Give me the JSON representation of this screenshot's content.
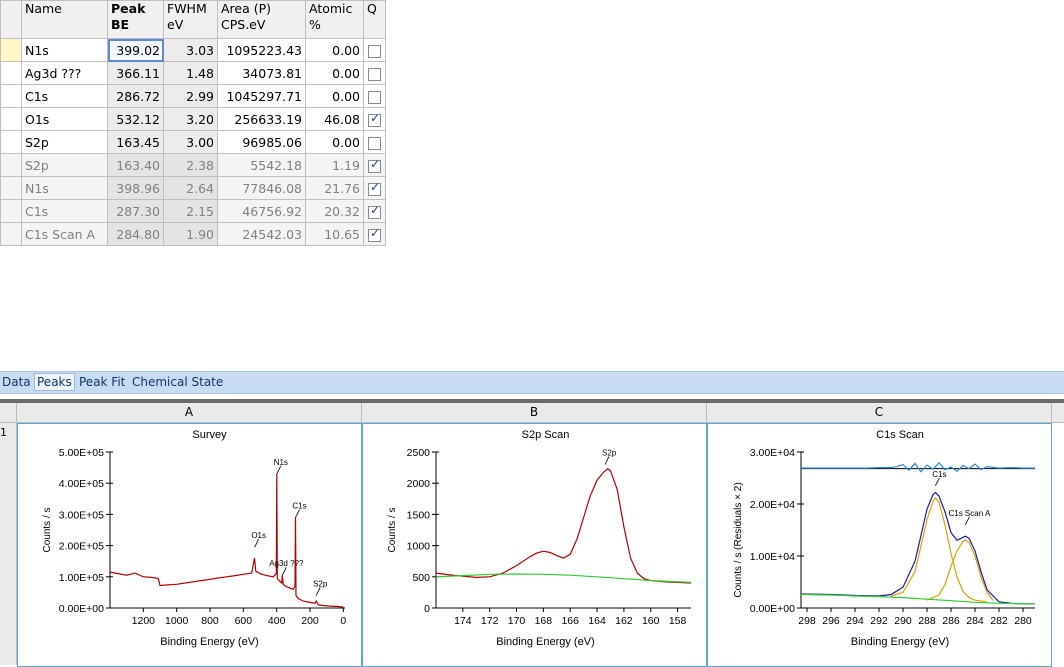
{
  "table": {
    "headers": [
      {
        "line1": "Name",
        "line2": ""
      },
      {
        "line1": "Peak",
        "line2": "BE"
      },
      {
        "line1": "FWHM",
        "line2": "eV"
      },
      {
        "line1": "Area (P)",
        "line2": "CPS.eV"
      },
      {
        "line1": "Atomic",
        "line2": "%"
      },
      {
        "line1": "Q",
        "line2": ""
      }
    ],
    "rows": [
      {
        "name": "N1s",
        "be": "399.02",
        "fwhm": "3.03",
        "area": "1095223.43",
        "atomic": "0.00",
        "q": false,
        "dim": false
      },
      {
        "name": "Ag3d ???",
        "be": "366.11",
        "fwhm": "1.48",
        "area": "34073.81",
        "atomic": "0.00",
        "q": false,
        "dim": false
      },
      {
        "name": "C1s",
        "be": "286.72",
        "fwhm": "2.99",
        "area": "1045297.71",
        "atomic": "0.00",
        "q": false,
        "dim": false
      },
      {
        "name": "O1s",
        "be": "532.12",
        "fwhm": "3.20",
        "area": "256633.19",
        "atomic": "46.08",
        "q": true,
        "dim": false
      },
      {
        "name": "S2p",
        "be": "163.45",
        "fwhm": "3.00",
        "area": "96985.06",
        "atomic": "0.00",
        "q": false,
        "dim": false
      },
      {
        "name": "S2p",
        "be": "163.40",
        "fwhm": "2.38",
        "area": "5542.18",
        "atomic": "1.19",
        "q": true,
        "dim": true
      },
      {
        "name": "N1s",
        "be": "398.96",
        "fwhm": "2.64",
        "area": "77846.08",
        "atomic": "21.76",
        "q": true,
        "dim": true
      },
      {
        "name": "C1s",
        "be": "287.30",
        "fwhm": "2.15",
        "area": "46756.92",
        "atomic": "20.32",
        "q": true,
        "dim": true
      },
      {
        "name": "C1s Scan A",
        "be": "284.80",
        "fwhm": "1.90",
        "area": "24542.03",
        "atomic": "10.65",
        "q": true,
        "dim": true
      }
    ]
  },
  "tabs": [
    "Data",
    "Peaks",
    "Peak Fit",
    "Chemical State"
  ],
  "active_tab": "Peaks",
  "grid": {
    "row_label": "1",
    "columns": [
      "A",
      "B",
      "C"
    ]
  },
  "colors": {
    "spectrum": "#b30000",
    "background": "#33cc33",
    "component": "#e0a000",
    "envelope": "#1a1aaa",
    "residual": "#2a8ad8",
    "panel_border": "#5aa8d8",
    "tabbar": "#c7dcf2"
  },
  "chart_data": [
    {
      "type": "line",
      "title": "Survey",
      "xlabel": "Binding Energy (eV)",
      "ylabel": "Counts / s",
      "xlim": [
        1400,
        -10
      ],
      "ylim": [
        0,
        500000
      ],
      "x_ticks": [
        "1200",
        "1000",
        "800",
        "600",
        "400",
        "200",
        "0"
      ],
      "y_ticks": [
        "0.00E+00",
        "1.00E+05",
        "2.00E+05",
        "3.00E+05",
        "4.00E+05",
        "5.00E+05"
      ],
      "annotations": [
        {
          "label": "N1s",
          "x": 399,
          "y": 430000
        },
        {
          "label": "O1s",
          "x": 532,
          "y": 195000
        },
        {
          "label": "C1s",
          "x": 287,
          "y": 290000
        },
        {
          "label": "Ag3d ???",
          "x": 366,
          "y": 105000
        },
        {
          "label": "S2p",
          "x": 163,
          "y": 40000
        }
      ],
      "series": [
        {
          "x": [
            1400,
            1300,
            1250,
            1200,
            1150,
            1110,
            1100,
            1050,
            1000,
            950,
            900,
            850,
            800,
            750,
            700,
            650,
            600,
            550,
            533,
            525,
            500,
            460,
            420,
            402,
            399,
            396,
            380,
            370,
            366,
            360,
            340,
            300,
            290,
            287,
            284,
            270,
            240,
            200,
            170,
            163,
            150,
            120,
            80,
            40,
            10,
            0
          ],
          "y": [
            115000,
            105000,
            112000,
            100000,
            98000,
            95000,
            72000,
            74000,
            76000,
            80000,
            84000,
            88000,
            92000,
            96000,
            100000,
            104000,
            108000,
            112000,
            160000,
            118000,
            110000,
            104000,
            100000,
            110000,
            430000,
            95000,
            85000,
            80000,
            105000,
            75000,
            68000,
            60000,
            70000,
            290000,
            40000,
            30000,
            22000,
            18000,
            15000,
            22000,
            10000,
            8000,
            6000,
            5000,
            4000,
            3000
          ]
        }
      ]
    },
    {
      "type": "line",
      "title": "S2p Scan",
      "xlabel": "Binding Energy (eV)",
      "ylabel": "Counts / s",
      "xlim": [
        176,
        157
      ],
      "ylim": [
        0,
        2500
      ],
      "x_ticks": [
        "174",
        "172",
        "170",
        "168",
        "166",
        "164",
        "162",
        "160",
        "158"
      ],
      "y_ticks": [
        "0",
        "500",
        "1000",
        "1500",
        "2000",
        "2500"
      ],
      "annotations": [
        {
          "label": "S2p",
          "x": 163.4,
          "y": 2300
        }
      ],
      "series": [
        {
          "name": "spectrum",
          "x": [
            176,
            175,
            174,
            173,
            172,
            171,
            170,
            169,
            168.5,
            168,
            167.5,
            167,
            166.5,
            166,
            165.5,
            165,
            164.5,
            164,
            163.5,
            163.2,
            163,
            162.5,
            162,
            161.5,
            161,
            160.5,
            160,
            159,
            158,
            157
          ],
          "y": [
            560,
            530,
            510,
            490,
            500,
            560,
            680,
            820,
            880,
            910,
            890,
            840,
            800,
            860,
            1100,
            1450,
            1800,
            2050,
            2180,
            2230,
            2200,
            1900,
            1300,
            800,
            560,
            470,
            440,
            420,
            410,
            400
          ]
        },
        {
          "name": "background",
          "x": [
            176,
            174,
            172,
            170,
            168,
            166,
            164,
            162,
            160,
            158,
            157
          ],
          "y": [
            500,
            520,
            540,
            545,
            540,
            525,
            500,
            470,
            440,
            420,
            410
          ]
        }
      ]
    },
    {
      "type": "line",
      "title": "C1s Scan",
      "xlabel": "Binding Energy (eV)",
      "ylabel": "Counts / s  (Residuals × 2)",
      "xlim": [
        298.5,
        279
      ],
      "ylim": [
        0,
        30000
      ],
      "x_ticks": [
        "298",
        "296",
        "294",
        "292",
        "290",
        "288",
        "286",
        "284",
        "282",
        "280"
      ],
      "y_ticks": [
        "0.00E+00",
        "1.00E+04",
        "2.00E+04",
        "3.00E+04"
      ],
      "annotations": [
        {
          "label": "C1s",
          "x": 287.3,
          "y": 23500
        },
        {
          "label": "C1s Scan A",
          "x": 284.8,
          "y": 16000
        }
      ],
      "series": [
        {
          "name": "envelope",
          "x": [
            298.5,
            296,
            294,
            292,
            291,
            290,
            289,
            288.5,
            288,
            287.5,
            287.3,
            287,
            286.5,
            286,
            285.5,
            285,
            284.8,
            284.5,
            284,
            283.5,
            283,
            282,
            281,
            280,
            279
          ],
          "y": [
            2700,
            2600,
            2400,
            2300,
            2600,
            4000,
            9000,
            14000,
            19000,
            21800,
            22200,
            21500,
            18500,
            14500,
            13000,
            13600,
            13800,
            13400,
            11000,
            7000,
            3500,
            1200,
            900,
            800,
            800
          ]
        },
        {
          "name": "C1s component",
          "x": [
            291,
            290,
            289,
            288.5,
            288,
            287.5,
            287.3,
            287,
            286.5,
            286,
            285.5,
            285,
            284.5,
            284,
            283
          ],
          "y": [
            2300,
            3000,
            7000,
            12000,
            17000,
            20500,
            21200,
            20300,
            16000,
            10500,
            6000,
            3200,
            2000,
            1500,
            1200
          ]
        },
        {
          "name": "C1s Scan A component",
          "x": [
            288,
            287,
            286.5,
            286,
            285.5,
            285,
            284.8,
            284.5,
            284,
            283.5,
            283,
            282.5
          ],
          "y": [
            1500,
            2500,
            4500,
            8000,
            11000,
            12800,
            13100,
            12600,
            10000,
            6000,
            3000,
            1500
          ]
        },
        {
          "name": "background",
          "x": [
            298.5,
            296,
            294,
            292,
            290,
            288,
            286,
            284,
            282,
            280,
            279
          ],
          "y": [
            2600,
            2500,
            2300,
            2200,
            2000,
            1700,
            1400,
            1100,
            900,
            800,
            800
          ]
        },
        {
          "name": "residual",
          "x": [
            298.5,
            297,
            296,
            295,
            294,
            293,
            292,
            291,
            290.5,
            290,
            289.5,
            289,
            288.5,
            288,
            287.5,
            287,
            286.5,
            286,
            285.5,
            285,
            284.5,
            284,
            283.5,
            283,
            282,
            281,
            280,
            279
          ],
          "y": [
            26900,
            26900,
            26900,
            26900,
            26900,
            26900,
            27000,
            27000,
            27200,
            27600,
            26500,
            27800,
            26200,
            27500,
            26700,
            27900,
            26600,
            27100,
            26300,
            27400,
            26800,
            27700,
            26600,
            27200,
            26900,
            27000,
            26900,
            26900
          ]
        }
      ],
      "residual_baseline": 26800
    }
  ]
}
